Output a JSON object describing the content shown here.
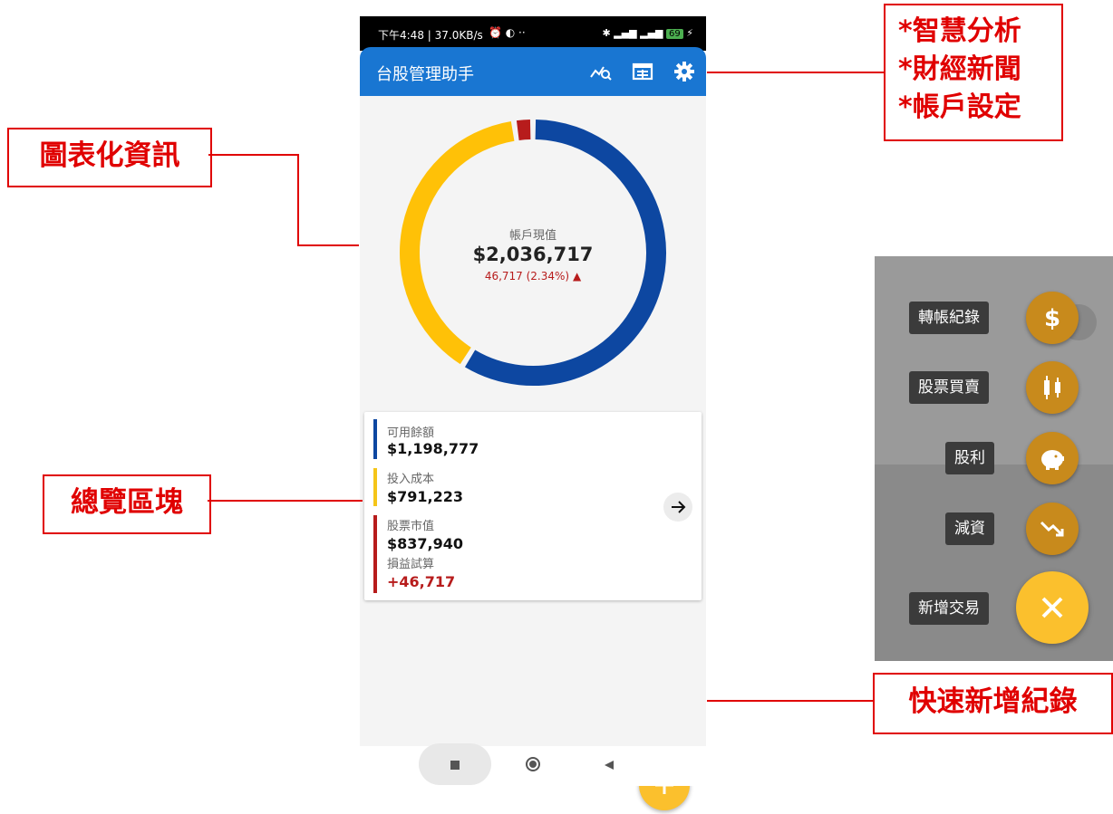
{
  "status_bar": {
    "left_text": "下午4:48 | 37.0KB/s",
    "right_text": "69"
  },
  "app": {
    "title": "台股管理助手",
    "toolbar_icons": [
      "analysis-icon",
      "news-icon",
      "gear-icon"
    ]
  },
  "donut": {
    "center_label": "帳戶現值",
    "center_value": "$2,036,717",
    "center_change": "46,717 (2.34%)",
    "change_arrow": "▲",
    "segments": [
      {
        "name": "可用餘額",
        "value": 1198777,
        "color": "#0D47A1"
      },
      {
        "name": "投入成本",
        "value": 791223,
        "color": "#FFC107"
      },
      {
        "name": "損益試算",
        "value": 46717,
        "color": "#B71C1C"
      }
    ]
  },
  "overview": {
    "items": [
      {
        "label": "可用餘額",
        "value": "$1,198,777",
        "color": "#0D47A1"
      },
      {
        "label": "投入成本",
        "value": "$791,223",
        "color": "#F5C518"
      },
      {
        "label": "股票市值",
        "value": "$837,940",
        "color": "#B71C1C"
      },
      {
        "label": "損益試算",
        "value": "+46,717",
        "color": "#B71C1C"
      }
    ]
  },
  "fab": {
    "icon": "plus-icon"
  },
  "navbar": {
    "icons": [
      "square-icon",
      "circle-icon",
      "back-triangle-icon"
    ]
  },
  "annotations": {
    "top_right": [
      "*智慧分析",
      "*財經新聞",
      "*帳戶設定"
    ],
    "chart": "圖表化資訊",
    "overview": "總覽區塊",
    "quick_add": "快速新增紀錄"
  },
  "fab_menu": {
    "items": [
      {
        "label": "轉帳紀錄",
        "icon": "dollar-icon"
      },
      {
        "label": "股票買賣",
        "icon": "candlestick-icon"
      },
      {
        "label": "股利",
        "icon": "piggy-bank-icon"
      },
      {
        "label": "減資",
        "icon": "trending-down-icon"
      },
      {
        "label": "新增交易",
        "icon": "close-icon"
      }
    ]
  }
}
